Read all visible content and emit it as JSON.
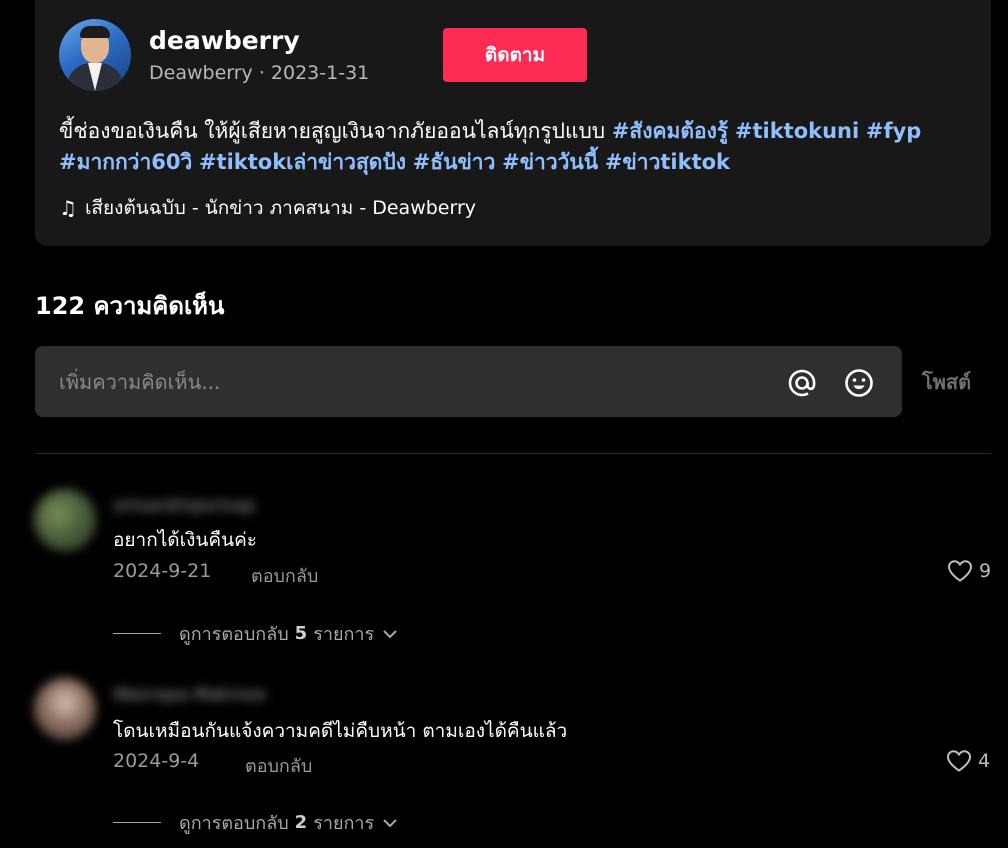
{
  "video": {
    "username": "deawberry",
    "nickname": "Deawberry",
    "separator": " · ",
    "date": "2023-1-31",
    "follow_label": "ติดตาม",
    "description": "ขี้ช่องขอเงินคืน ให้ผู้เสียหายสูญเงินจากภัยออนไลน์ทุกรูปแบบ",
    "hashtags": [
      "#สังคมต้องรู้",
      "#tiktokuni",
      "#fyp",
      "#มากกว่า60วิ",
      "#tiktokเล่าข่าวสุดปัง",
      "#ธันข่าว",
      "#ข่าววันนี้",
      "#ข่าวtiktok"
    ],
    "music": "เสียงต้นฉบับ - นักข่าว ภาคสนาม - Deawberry",
    "music_icon": "music-note-icon"
  },
  "comments_header": {
    "count": "122",
    "label": "ความคิดเห็น"
  },
  "comment_input": {
    "placeholder": "เพิ่มความคิดเห็น...",
    "mention_icon": "at-icon",
    "emoji_icon": "emoji-icon",
    "post_label": "โพสต์"
  },
  "comments": [
    {
      "name": "sirisankhipsrisap",
      "text": "อยากได้เงินคืนค่ะ",
      "date": "2024-9-21",
      "reply_label": "ตอบกลับ",
      "likes": "9",
      "view_replies_label": "ดูการตอบกลับ",
      "replies_count": "5",
      "replies_unit": "รายการ"
    },
    {
      "name": "Wanrapa Makmee",
      "text": "โดนเหมือนกันแจ้งความคดีไม่คืบหน้า ตามเองได้คืนแล้ว",
      "date": "2024-9-4",
      "reply_label": "ตอบกลับ",
      "likes": "4",
      "view_replies_label": "ดูการตอบกลับ",
      "replies_count": "2",
      "replies_unit": "รายการ"
    }
  ],
  "colors": {
    "accent": "#fe2c55",
    "hashtag": "#8fbfff",
    "background": "#000000",
    "card": "#181818",
    "input_bg": "#2f2f2f"
  }
}
